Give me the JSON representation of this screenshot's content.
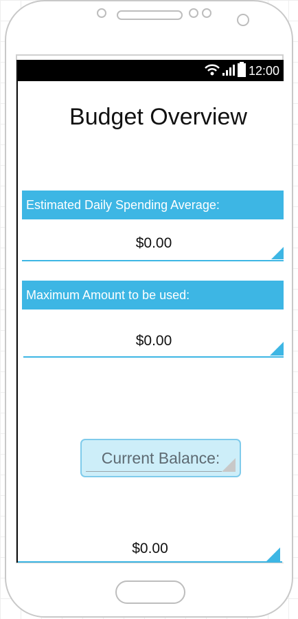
{
  "status_bar": {
    "time": "12:00",
    "icons": [
      "wifi-icon",
      "signal-icon",
      "battery-icon"
    ]
  },
  "page": {
    "title": "Budget Overview"
  },
  "daily_spending": {
    "label": "Estimated Daily Spending Average:",
    "value": "$0.00"
  },
  "max_amount": {
    "label": "Maximum Amount to be used:",
    "value": "$0.00"
  },
  "current_balance": {
    "button_label": "Current Balance:",
    "value": "$0.00"
  },
  "colors": {
    "accent": "#3db6e4",
    "button_fill": "#cdeef9",
    "button_border": "#7fcbeb",
    "status_bar": "#000000"
  }
}
